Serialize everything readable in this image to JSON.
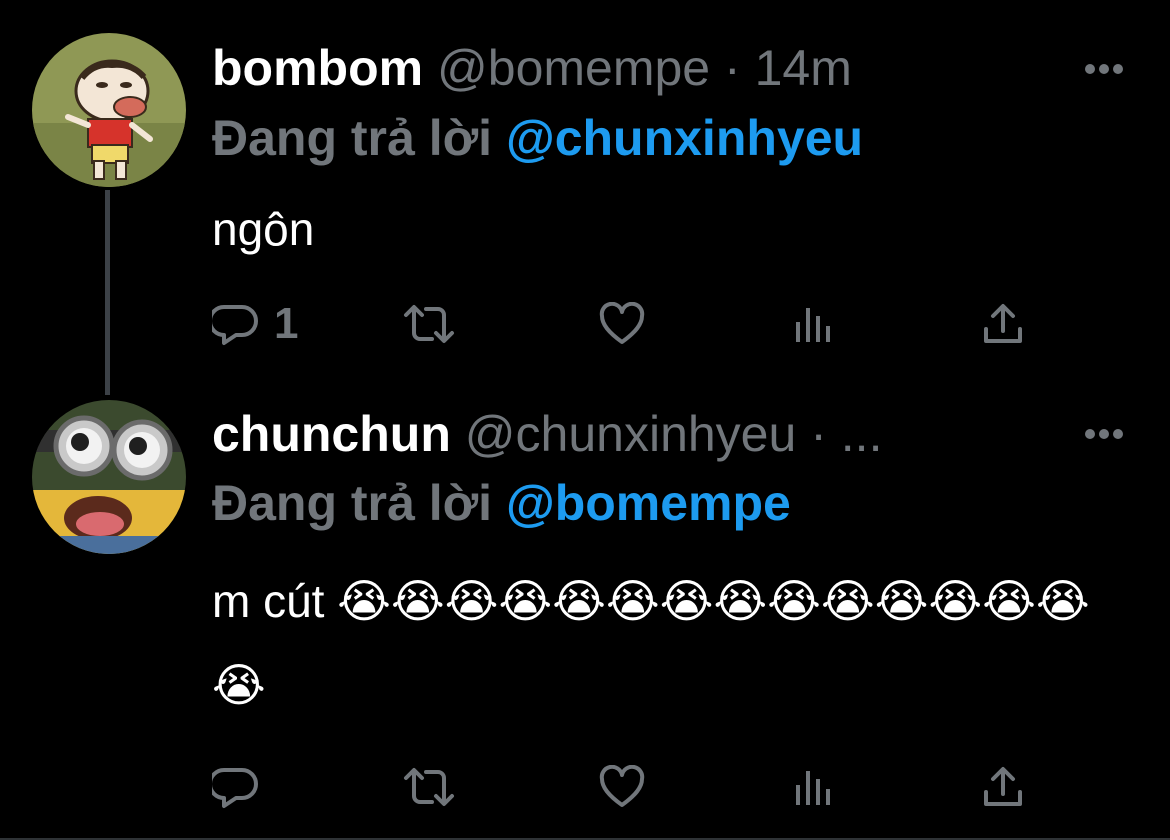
{
  "thread": {
    "tweets": [
      {
        "display_name": "bombom",
        "handle": "@bomempe",
        "separator": "·",
        "time": "14m",
        "reply_prefix": "Đang trả lời",
        "reply_to": "@chunxinhyeu",
        "text": "ngôn",
        "reply_count": "1",
        "avatar_icon": "cartoon-boy-avatar"
      },
      {
        "display_name": "chunchun",
        "handle": "@chunxinhyeu",
        "separator": "·",
        "time": "...",
        "reply_prefix": "Đang trả lời",
        "reply_to": "@bomempe",
        "text": "m cút 😭😭😭😭😭😭😭😭😭😭😭😭😭😭😭",
        "reply_count": "",
        "avatar_icon": "minion-avatar"
      }
    ]
  },
  "icons": {
    "reply": "reply-icon",
    "retweet": "retweet-icon",
    "like": "heart-icon",
    "views": "views-icon",
    "share": "share-icon",
    "more": "more-icon"
  },
  "colors": {
    "background": "#000000",
    "text": "#ffffff",
    "muted": "#71767b",
    "accent": "#1d9bf0"
  }
}
